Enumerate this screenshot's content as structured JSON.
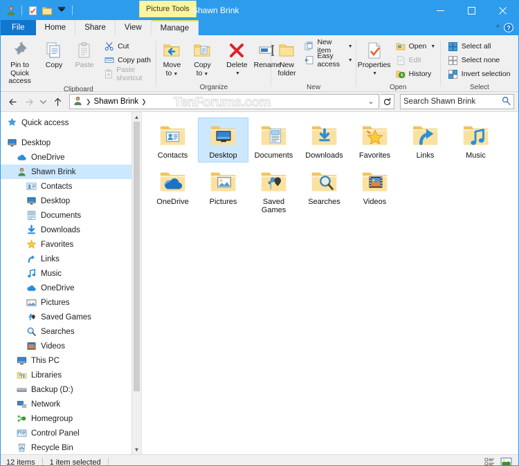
{
  "window": {
    "title": "Shawn Brink",
    "contextual_tab": "Picture Tools",
    "controls": {
      "minimize": "minimize-button",
      "maximize": "maximize-button",
      "close": "close-button"
    }
  },
  "quick_access_toolbar": {
    "items": [
      {
        "name": "user-account-icon",
        "label": "Shawn Brink"
      },
      {
        "name": "properties-icon",
        "label": "Properties"
      },
      {
        "name": "new-folder-icon",
        "label": "New folder"
      },
      {
        "name": "customize-qat-icon",
        "label": "Customize Quick Access Toolbar"
      }
    ]
  },
  "ribbon": {
    "tabs": [
      {
        "label": "File",
        "active": false,
        "style": "file"
      },
      {
        "label": "Home",
        "active": true,
        "style": "normal"
      },
      {
        "label": "Share",
        "active": false,
        "style": "normal"
      },
      {
        "label": "View",
        "active": false,
        "style": "normal"
      },
      {
        "label": "Manage",
        "active": false,
        "style": "contextual"
      }
    ],
    "collapse_label": "^",
    "help_label": "?",
    "groups": [
      {
        "label": "Clipboard",
        "big_buttons": [
          {
            "label": "Pin to Quick access",
            "icon": "pin-icon",
            "disabled": false
          },
          {
            "label": "Copy",
            "icon": "copy-icon",
            "disabled": false
          },
          {
            "label": "Paste",
            "icon": "paste-icon",
            "disabled": true
          }
        ],
        "small_buttons": [
          {
            "label": "Cut",
            "icon": "scissors-icon",
            "disabled": false
          },
          {
            "label": "Copy path",
            "icon": "copy-path-icon",
            "disabled": false
          },
          {
            "label": "Paste shortcut",
            "icon": "paste-shortcut-icon",
            "disabled": true
          }
        ]
      },
      {
        "label": "Organize",
        "big_buttons": [
          {
            "label": "Move to",
            "icon": "move-to-icon",
            "dropdown": true
          },
          {
            "label": "Copy to",
            "icon": "copy-to-icon",
            "dropdown": true
          },
          {
            "label": "Delete",
            "icon": "delete-icon",
            "dropdown": true
          },
          {
            "label": "Rename",
            "icon": "rename-icon",
            "dropdown": false
          }
        ]
      },
      {
        "label": "New",
        "big_buttons": [
          {
            "label": "New folder",
            "icon": "new-folder-icon"
          }
        ],
        "small_buttons": [
          {
            "label": "New item",
            "icon": "new-item-icon",
            "dropdown": true
          },
          {
            "label": "Easy access",
            "icon": "easy-access-icon",
            "dropdown": true
          }
        ]
      },
      {
        "label": "Open",
        "big_buttons": [
          {
            "label": "Properties",
            "icon": "properties-icon",
            "dropdown": true
          }
        ],
        "small_buttons": [
          {
            "label": "Open",
            "icon": "open-icon",
            "dropdown": true,
            "disabled": false
          },
          {
            "label": "Edit",
            "icon": "edit-icon",
            "dropdown": false,
            "disabled": true
          },
          {
            "label": "History",
            "icon": "history-icon",
            "dropdown": false,
            "disabled": false
          }
        ]
      },
      {
        "label": "Select",
        "small_buttons": [
          {
            "label": "Select all",
            "icon": "select-all-icon"
          },
          {
            "label": "Select none",
            "icon": "select-none-icon"
          },
          {
            "label": "Invert selection",
            "icon": "invert-selection-icon"
          }
        ]
      }
    ]
  },
  "navbar": {
    "back": "back-arrow",
    "forward": "forward-arrow",
    "recent": "recent-locations-chevron",
    "up": "up-arrow",
    "breadcrumb": [
      "Shawn Brink"
    ],
    "watermark": "TenForums.com",
    "dropdown": "address-dropdown",
    "refresh": "refresh-icon",
    "search_placeholder": "Search Shawn Brink"
  },
  "navigation_pane": {
    "items": [
      {
        "label": "Quick access",
        "icon": "quick-access-star-icon",
        "level": 0,
        "selected": false,
        "gap_after": true
      },
      {
        "label": "Desktop",
        "icon": "desktop-monitor-icon",
        "level": 0,
        "selected": false
      },
      {
        "label": "OneDrive",
        "icon": "onedrive-cloud-icon",
        "level": 1,
        "selected": false
      },
      {
        "label": "Shawn Brink",
        "icon": "user-account-icon",
        "level": 1,
        "selected": true
      },
      {
        "label": "Contacts",
        "icon": "contacts-card-icon",
        "level": 2,
        "selected": false
      },
      {
        "label": "Desktop",
        "icon": "desktop-monitor-icon",
        "level": 2,
        "selected": false
      },
      {
        "label": "Documents",
        "icon": "documents-icon",
        "level": 2,
        "selected": false
      },
      {
        "label": "Downloads",
        "icon": "downloads-arrow-icon",
        "level": 2,
        "selected": false
      },
      {
        "label": "Favorites",
        "icon": "favorites-star-icon",
        "level": 2,
        "selected": false
      },
      {
        "label": "Links",
        "icon": "links-arrow-icon",
        "level": 2,
        "selected": false
      },
      {
        "label": "Music",
        "icon": "music-note-icon",
        "level": 2,
        "selected": false
      },
      {
        "label": "OneDrive",
        "icon": "onedrive-cloud-icon",
        "level": 2,
        "selected": false
      },
      {
        "label": "Pictures",
        "icon": "pictures-icon",
        "level": 2,
        "selected": false
      },
      {
        "label": "Saved Games",
        "icon": "saved-games-icon",
        "level": 2,
        "selected": false
      },
      {
        "label": "Searches",
        "icon": "searches-magnifier-icon",
        "level": 2,
        "selected": false
      },
      {
        "label": "Videos",
        "icon": "videos-film-icon",
        "level": 2,
        "selected": false
      },
      {
        "label": "This PC",
        "icon": "this-pc-icon",
        "level": 1,
        "selected": false
      },
      {
        "label": "Libraries",
        "icon": "libraries-icon",
        "level": 1,
        "selected": false
      },
      {
        "label": "Backup (D:)",
        "icon": "drive-icon",
        "level": 1,
        "selected": false
      },
      {
        "label": "Network",
        "icon": "network-icon",
        "level": 1,
        "selected": false
      },
      {
        "label": "Homegroup",
        "icon": "homegroup-icon",
        "level": 1,
        "selected": false
      },
      {
        "label": "Control Panel",
        "icon": "control-panel-icon",
        "level": 1,
        "selected": false
      },
      {
        "label": "Recycle Bin",
        "icon": "recycle-bin-icon",
        "level": 1,
        "selected": false
      }
    ]
  },
  "content": {
    "items": [
      {
        "label": "Contacts",
        "icon": "folder-contacts-icon",
        "selected": false
      },
      {
        "label": "Desktop",
        "icon": "folder-desktop-icon",
        "selected": true
      },
      {
        "label": "Documents",
        "icon": "folder-documents-icon",
        "selected": false
      },
      {
        "label": "Downloads",
        "icon": "folder-downloads-icon",
        "selected": false
      },
      {
        "label": "Favorites",
        "icon": "folder-favorites-icon",
        "selected": false
      },
      {
        "label": "Links",
        "icon": "folder-links-icon",
        "selected": false
      },
      {
        "label": "Music",
        "icon": "folder-music-icon",
        "selected": false
      },
      {
        "label": "OneDrive",
        "icon": "folder-onedrive-icon",
        "selected": false
      },
      {
        "label": "Pictures",
        "icon": "folder-pictures-icon",
        "selected": false
      },
      {
        "label": "Saved Games",
        "icon": "folder-saved-games-icon",
        "selected": false
      },
      {
        "label": "Searches",
        "icon": "folder-searches-icon",
        "selected": false
      },
      {
        "label": "Videos",
        "icon": "folder-videos-icon",
        "selected": false
      }
    ]
  },
  "status_bar": {
    "item_count": "12 items",
    "selection": "1 item selected",
    "view_details": "details-view-button",
    "view_large_icons": "large-icons-view-button"
  }
}
